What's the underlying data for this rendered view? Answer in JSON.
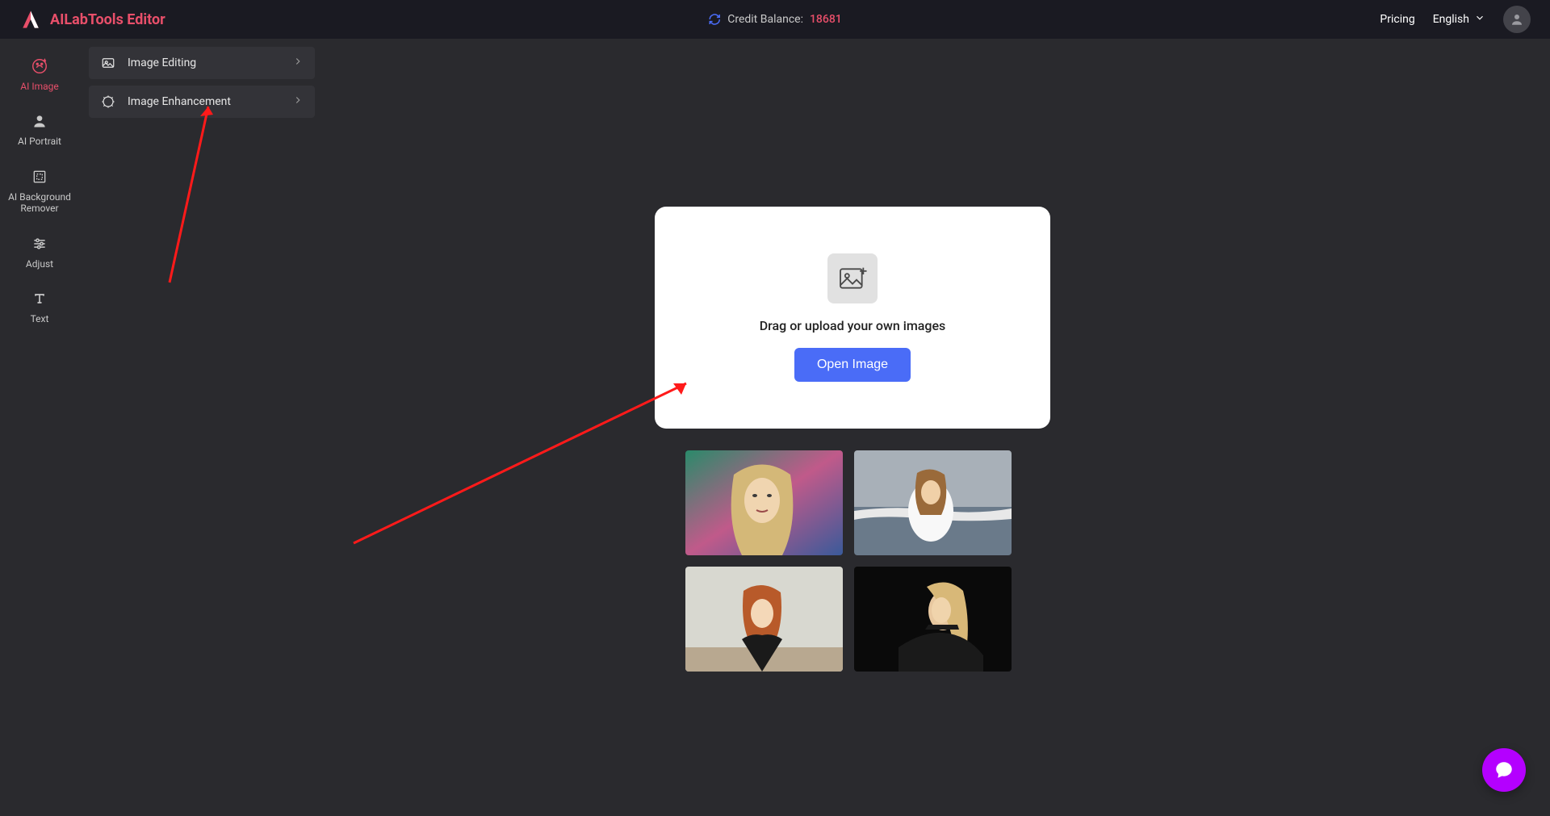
{
  "header": {
    "brand": "AILabTools Editor",
    "credit_label": "Credit Balance:",
    "credit_value": "18681",
    "pricing": "Pricing",
    "language": "English"
  },
  "sidebar": {
    "items": [
      {
        "label": "AI Image"
      },
      {
        "label": "AI Portrait"
      },
      {
        "label": "AI Background Remover"
      },
      {
        "label": "Adjust"
      },
      {
        "label": "Text"
      }
    ]
  },
  "submenu": {
    "items": [
      {
        "label": "Image Editing"
      },
      {
        "label": "Image Enhancement"
      }
    ]
  },
  "upload": {
    "prompt": "Drag or upload your own images",
    "button": "Open Image"
  }
}
